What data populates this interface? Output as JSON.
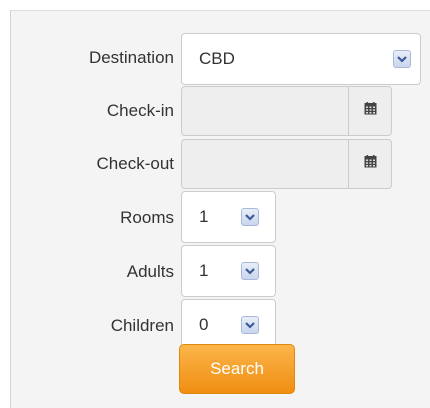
{
  "form": {
    "destination": {
      "label": "Destination",
      "value": "CBD"
    },
    "check_in": {
      "label": "Check-in",
      "value": ""
    },
    "check_out": {
      "label": "Check-out",
      "value": ""
    },
    "rooms": {
      "label": "Rooms",
      "value": "1"
    },
    "adults": {
      "label": "Adults",
      "value": "1"
    },
    "children": {
      "label": "Children",
      "value": "0"
    },
    "search_label": "Search"
  },
  "icons": {
    "dropdown": "chevron-down-icon",
    "calendar": "calendar-icon"
  },
  "colors": {
    "panel_bg": "#f4f4f4",
    "button_top": "#fbb54a",
    "button_bottom": "#f08e12",
    "dropdown_arrow": "#3c5a99"
  }
}
